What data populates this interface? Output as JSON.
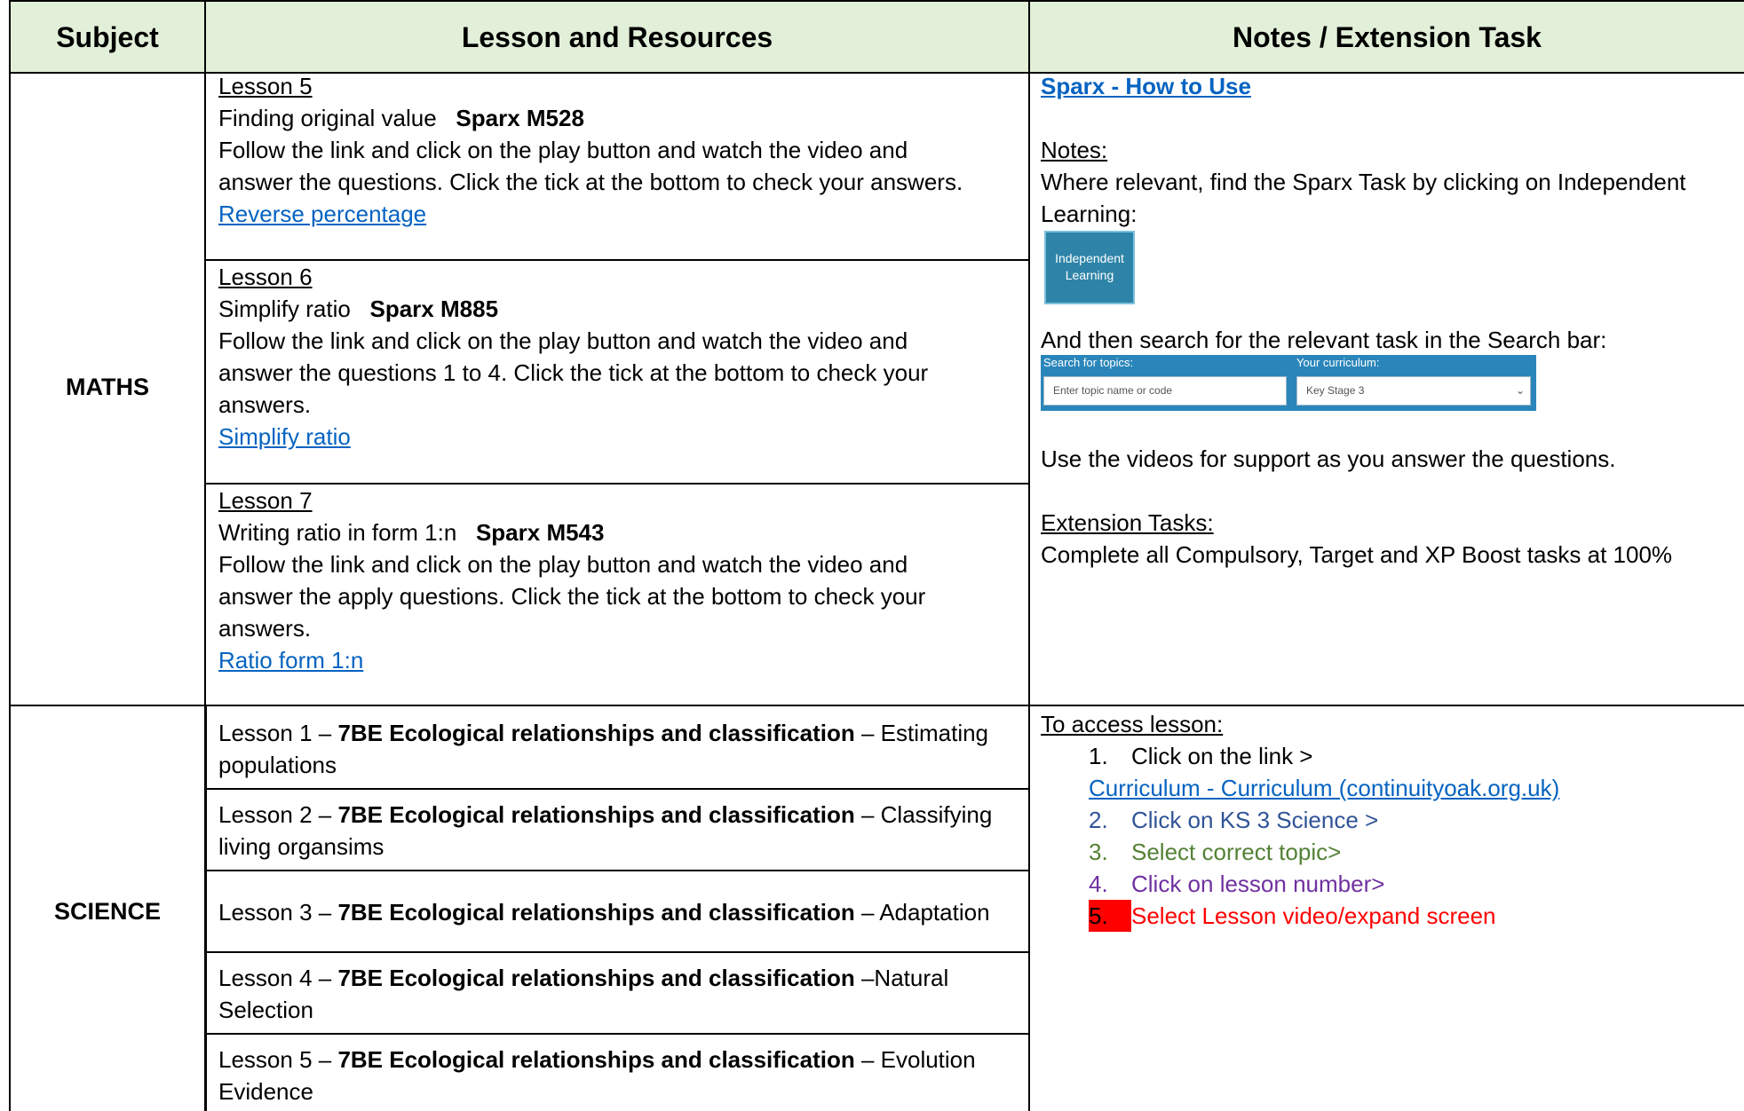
{
  "header": {
    "subject": "Subject",
    "lesson": "Lesson and Resources",
    "notes": "Notes / Extension Task"
  },
  "maths": {
    "subject": "MATHS",
    "lessons": [
      {
        "title": "Lesson 5",
        "topic": "Finding original value",
        "code": "Sparx M528",
        "line1": "Follow the link and click on the play button and watch the video and",
        "line2": "answer the questions. Click the tick at the bottom to check your answers.",
        "line3": "",
        "link": "Reverse percentage"
      },
      {
        "title": "Lesson 6",
        "topic": "Simplify ratio",
        "code": "Sparx M885",
        "line1": "Follow the link and click on the play button and watch the video and",
        "line2": "answer the questions 1 to 4. Click the tick at the bottom to check your",
        "line3": "answers.",
        "link": "Simplify ratio"
      },
      {
        "title": "Lesson 7",
        "topic": "Writing ratio in form 1:n",
        "code": "Sparx M543",
        "line1": "Follow the link and click on the play button and watch the video and",
        "line2": "answer the apply questions. Click the tick at the bottom to check your",
        "line3": "answers.",
        "link": "Ratio form 1:n"
      }
    ],
    "notes": {
      "how_to_link": "Sparx - How to Use",
      "notes_heading": "Notes:",
      "notes_line1": "Where relevant, find the Sparx Task by clicking on Independent",
      "notes_line2": "Learning:",
      "il_button_line1": "Independent",
      "il_button_line2": "Learning",
      "search_text": "And then search for the relevant task in the Search bar:",
      "search_topics_label": "Search for topics:",
      "search_placeholder": "Enter topic name or code",
      "curriculum_label": "Your curriculum:",
      "curriculum_value": "Key Stage 3",
      "videos_text": "Use the videos for support as you answer the questions.",
      "ext_heading": "Extension Tasks:",
      "ext_text": "Complete all Compulsory, Target and XP Boost tasks at 100%"
    }
  },
  "science": {
    "subject": "SCIENCE",
    "lessons": [
      {
        "pre": "Lesson 1 – ",
        "bold": "7BE Ecological relationships and classification",
        "post1": " – Estimating",
        "post2": "populations"
      },
      {
        "pre": "Lesson 2 – ",
        "bold": "7BE Ecological relationships and classification",
        "post1": " – Classifying",
        "post2": "living organsims"
      },
      {
        "pre": "Lesson 3 – ",
        "bold": "7BE Ecological relationships and classification",
        "post1": " – Adaptation",
        "post2": ""
      },
      {
        "pre": "Lesson 4 – ",
        "bold": "7BE Ecological relationships and classification",
        "post1": " –Natural",
        "post2": "Selection"
      },
      {
        "pre": "Lesson 5 – ",
        "bold": "7BE Ecological relationships and classification",
        "post1": " – Evolution",
        "post2": "Evidence"
      }
    ],
    "notes": {
      "heading": "To access lesson:",
      "step1_num": "1.",
      "step1": "Click on the link >",
      "link": "Curriculum - Curriculum (continuityoak.org.uk)",
      "step2_num": "2.",
      "step2": "Click on KS 3 Science >",
      "step3_num": "3.",
      "step3": "Select correct topic>",
      "step4_num": "4.",
      "step4": "Click on lesson number>",
      "step5_num": "5.",
      "step5": "Select Lesson video/expand screen"
    }
  },
  "colors": {
    "header_bg": "#e2efd9",
    "link": "#0563c1",
    "step2": "#2f5496",
    "step3": "#538135",
    "step4": "#7030a0",
    "step5": "#ff0000"
  }
}
